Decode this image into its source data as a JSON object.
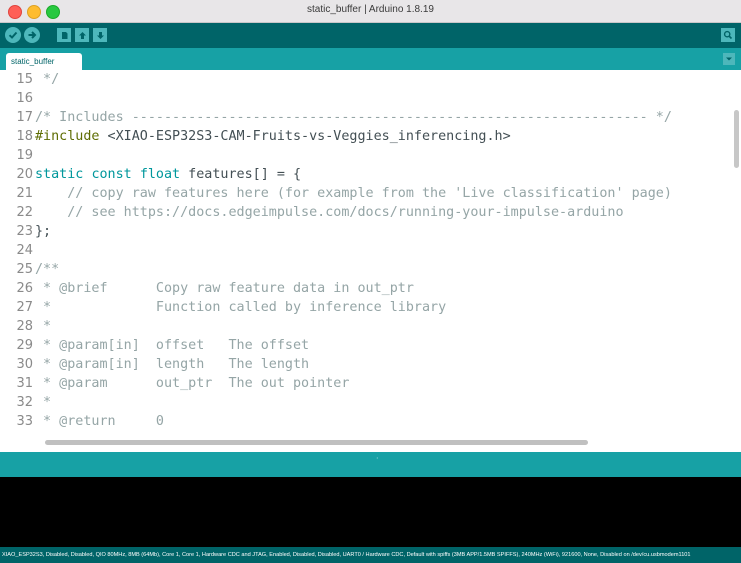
{
  "window": {
    "title": "static_buffer | Arduino 1.8.19"
  },
  "toolbar": {
    "buttons": [
      {
        "name": "verify-icon"
      },
      {
        "name": "upload-icon"
      },
      {
        "name": "new-icon"
      },
      {
        "name": "open-icon"
      },
      {
        "name": "save-icon"
      },
      {
        "name": "serial-monitor-icon"
      }
    ]
  },
  "tabs": [
    {
      "label": "static_buffer",
      "active": true
    }
  ],
  "editor": {
    "lines": [
      {
        "n": "15",
        "text": " */"
      },
      {
        "n": "16",
        "text": ""
      },
      {
        "n": "17",
        "text": "/* Includes ---------------------------------------------------------------- */"
      },
      {
        "n": "18",
        "text": "#include <XIAO-ESP32S3-CAM-Fruits-vs-Veggies_inferencing.h>"
      },
      {
        "n": "19",
        "text": ""
      },
      {
        "n": "20",
        "text": "static const float features[] = {"
      },
      {
        "n": "21",
        "text": "    // copy raw features here (for example from the 'Live classification' page)"
      },
      {
        "n": "22",
        "text": "    // see https://docs.edgeimpulse.com/docs/running-your-impulse-arduino"
      },
      {
        "n": "23",
        "text": "};"
      },
      {
        "n": "24",
        "text": ""
      },
      {
        "n": "25",
        "text": "/**"
      },
      {
        "n": "26",
        "text": " * @brief      Copy raw feature data in out_ptr"
      },
      {
        "n": "27",
        "text": " *             Function called by inference library"
      },
      {
        "n": "28",
        "text": " *"
      },
      {
        "n": "29",
        "text": " * @param[in]  offset   The offset"
      },
      {
        "n": "30",
        "text": " * @param[in]  length   The length"
      },
      {
        "n": "31",
        "text": " * @param      out_ptr  The out pointer"
      },
      {
        "n": "32",
        "text": " *"
      },
      {
        "n": "33",
        "text": " * @return     0"
      }
    ]
  },
  "status": {
    "message": ""
  },
  "board_info": "XIAO_ESP32S3, Disabled, Disabled, QIO 80MHz, 8MB (64Mb), Core 1, Core 1, Hardware CDC and JTAG, Enabled, Disabled, Disabled, UART0 / Hardware CDC, Default with spiffs (3MB APP/1.5MB SPIFFS), 240MHz (WiFi), 921600, None, Disabled on /dev/cu.usbmodem1101",
  "colors": {
    "toolbar": "#006468",
    "tabbar": "#17a1a5",
    "keyword": "#00979c",
    "preprocessor": "#5e6d03",
    "comment": "#95a5a6",
    "function": "#d35400"
  }
}
